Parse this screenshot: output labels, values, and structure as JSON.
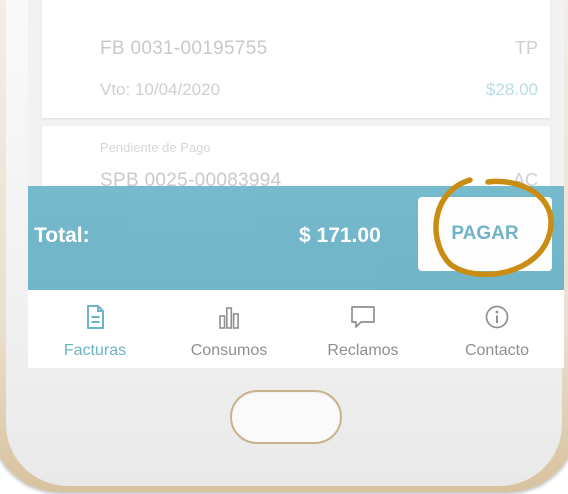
{
  "invoices": [
    {
      "number": "FB 0031-00195755",
      "due": "Vto: 10/04/2020",
      "code": "TP",
      "amount": "$28.00"
    },
    {
      "status": "Pendiente de Pago",
      "number": "SPB 0025-00083994",
      "code": "AC"
    }
  ],
  "summary": {
    "total_label": "Total:",
    "total_value": "$ 171.00",
    "pay_label": "PAGAR"
  },
  "tabs": [
    {
      "label": "Facturas",
      "icon": "document-icon",
      "active": true
    },
    {
      "label": "Consumos",
      "icon": "bar-chart-icon",
      "active": false
    },
    {
      "label": "Reclamos",
      "icon": "chat-bubble-icon",
      "active": false
    },
    {
      "label": "Contacto",
      "icon": "info-icon",
      "active": false
    }
  ],
  "colors": {
    "accent": "#6db3c7",
    "highlight_circle": "#c98d14",
    "text_muted": "#8f8f8f"
  }
}
